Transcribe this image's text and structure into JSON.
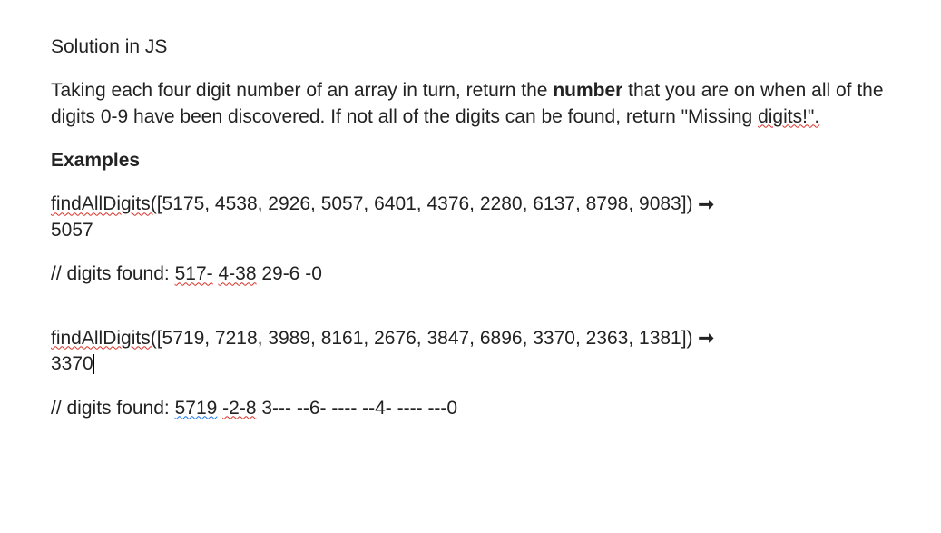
{
  "title": "Solution in JS",
  "intro": {
    "pre": "Taking each four digit number of an array in turn, return the ",
    "bold": "number",
    "mid": " that you are on when all of the digits 0-9 have been discovered. If not all of the digits can be found, return \"Missing ",
    "err_word": "digits!\".",
    "post": ""
  },
  "examples_heading": "Examples",
  "example1": {
    "fn_name": "findAllDigits(",
    "args": "[5175, 4538, 2926, 5057, 6401, 4376, 2280, 6137, 8798, 9083]) ",
    "arrow": "➞",
    "result": "5057",
    "comment_pre": "// digits found:  ",
    "d1": "517-",
    "d2": "  ",
    "d3": "4-38",
    "d4": "  29-6  -0"
  },
  "example2": {
    "fn_name": "findAllDigits(",
    "args": "[5719, 7218, 3989, 8161, 2676, 3847, 6896, 3370, 2363, 1381]) ",
    "arrow": "➞",
    "result": "3370",
    "comment_pre": "// digits found:  ",
    "d1": "5719",
    "d2": "  ",
    "d3": "-2-8",
    "d4": "  3---  --6-  ----  --4-  ----  ---0"
  }
}
